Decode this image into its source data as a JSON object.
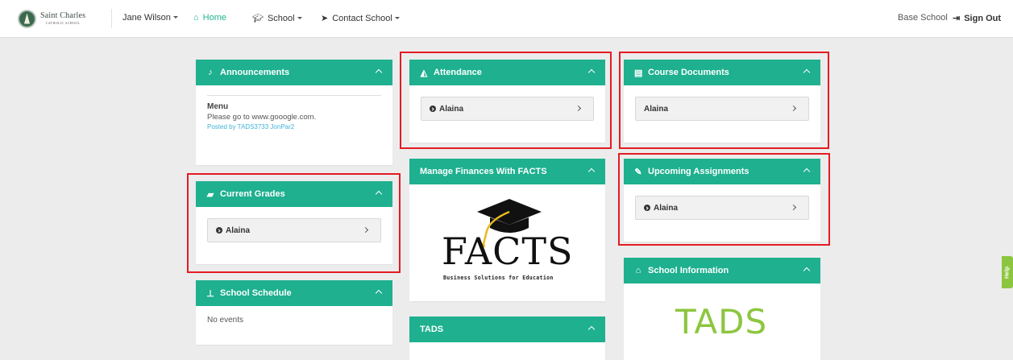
{
  "brand": {
    "name": "Saint Charles",
    "sub": "CATHOLIC SCHOOL"
  },
  "nav": {
    "user": "Jane Wilson",
    "home": "Home",
    "school": "School",
    "contact": "Contact School",
    "base_school": "Base School",
    "sign_out": "Sign Out"
  },
  "panels": {
    "announcements": {
      "title": "Announcements",
      "menu": "Menu",
      "text": "Please go to www.gooogle.com.",
      "posted_by": "Posted by TADS3733 JonPar2"
    },
    "attendance": {
      "title": "Attendance",
      "student": "Alaina"
    },
    "course_documents": {
      "title": "Course Documents",
      "student": "Alaina"
    },
    "current_grades": {
      "title": "Current Grades",
      "student": "Alaina"
    },
    "manage_finances": {
      "title": "Manage Finances With FACTS",
      "logo_word": "FACTS",
      "logo_tagline": "Business Solutions for Education"
    },
    "upcoming_assignments": {
      "title": "Upcoming Assignments",
      "student": "Alaina"
    },
    "school_schedule": {
      "title": "School Schedule",
      "empty": "No events"
    },
    "school_information": {
      "title": "School Information",
      "logo_word": "TADS"
    },
    "tads": {
      "title": "TADS"
    }
  },
  "help_tab": "Help",
  "colors": {
    "accent": "#1eb08f",
    "highlight": "#e41b23",
    "home_link": "#1fb591",
    "help": "#8cc63f"
  }
}
